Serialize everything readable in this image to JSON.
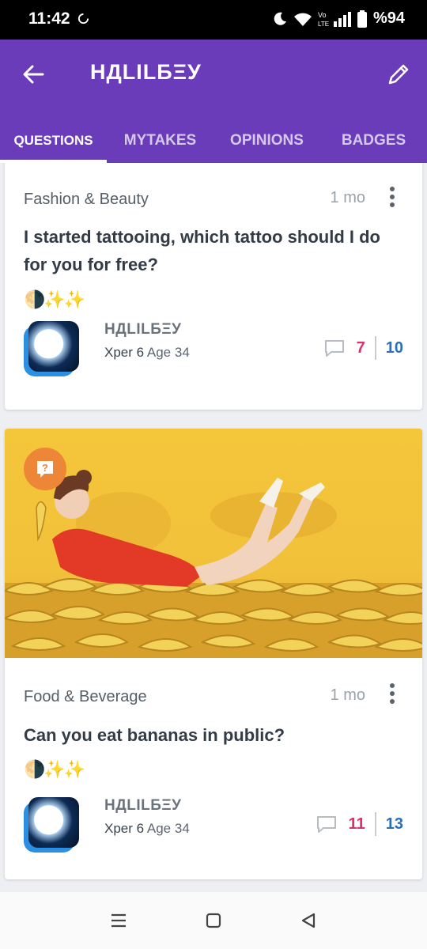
{
  "status_bar": {
    "time": "11:42",
    "battery": "%94",
    "network": "Vo LTE"
  },
  "app_bar": {
    "title": "НДLILБΞУ"
  },
  "tabs": [
    {
      "label": "QUESTIONS",
      "active": true
    },
    {
      "label": "MYTAKES",
      "active": false
    },
    {
      "label": "OPINIONS",
      "active": false
    },
    {
      "label": "BADGES",
      "active": false
    }
  ],
  "posts": [
    {
      "category": "Fashion & Beauty",
      "time": "1 mo",
      "title": "I started tattooing, which tattoo should I do for you for free?",
      "emoji": "🌗✨✨",
      "author": {
        "name": "НДLILБΞУ",
        "level": "Xper 6",
        "age": "Age 34"
      },
      "opinions": "7",
      "votes": "10"
    },
    {
      "category": "Food & Beverage",
      "time": "1 mo",
      "title": "Can you eat bananas in public?",
      "emoji": "🌗✨✨",
      "author": {
        "name": "НДLILБΞУ",
        "level": "Xper 6",
        "age": "Age 34"
      },
      "opinions": "11",
      "votes": "13",
      "badge": "?"
    }
  ],
  "colors": {
    "primary": "#6a3cb9",
    "accent_pink": "#d6336c",
    "accent_blue": "#2b6fb8",
    "badge_orange": "#ee8637"
  }
}
